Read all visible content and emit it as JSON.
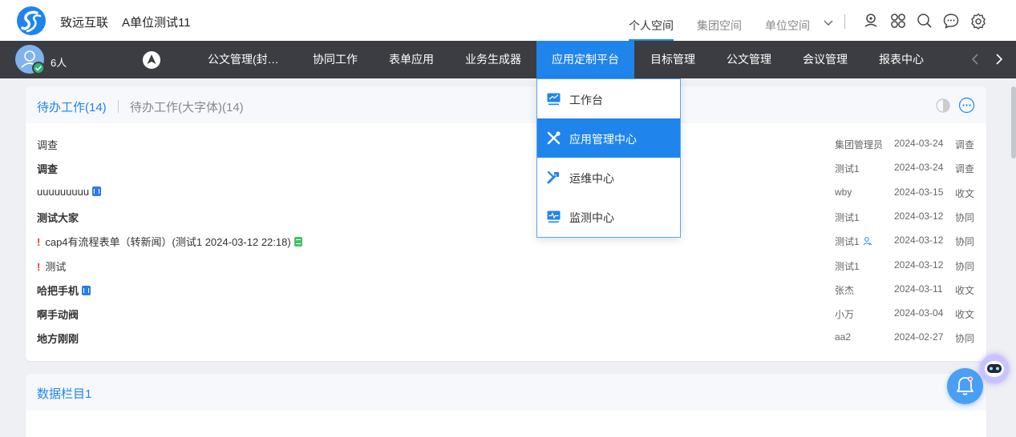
{
  "header": {
    "brand": "致远互联",
    "unit": "A单位测试11",
    "space_tabs": [
      {
        "label": "个人空间",
        "active": true
      },
      {
        "label": "集团空间",
        "active": false
      },
      {
        "label": "单位空间",
        "active": false
      }
    ],
    "icons": [
      "location-pin-icon",
      "apps-icon",
      "search-icon",
      "chat-icon",
      "settings-icon"
    ]
  },
  "navbar": {
    "online_count": "6人",
    "items": [
      {
        "label": "公文管理(封…",
        "active": false
      },
      {
        "label": "协同工作",
        "active": false
      },
      {
        "label": "表单应用",
        "active": false
      },
      {
        "label": "业务生成器",
        "active": false
      },
      {
        "label": "应用定制平台",
        "active": true
      },
      {
        "label": "目标管理",
        "active": false
      },
      {
        "label": "公文管理",
        "active": false
      },
      {
        "label": "会议管理",
        "active": false
      },
      {
        "label": "报表中心",
        "active": false
      }
    ]
  },
  "todo": {
    "tab_active": "待办工作(14)",
    "tab_other": "待办工作(大字体)(14)",
    "rows": [
      {
        "title": "调查",
        "bold": false,
        "urgent": false,
        "badge": "",
        "sender": "集团管理员",
        "person_icon": false,
        "date": "2024-03-24",
        "type": "调查"
      },
      {
        "title": "调查",
        "bold": true,
        "urgent": false,
        "badge": "",
        "sender": "测试1",
        "person_icon": false,
        "date": "2024-03-24",
        "type": "调查"
      },
      {
        "title": "uuuuuuuuu",
        "bold": false,
        "urgent": false,
        "badge": "word",
        "sender": "wby",
        "person_icon": false,
        "date": "2024-03-15",
        "type": "收文"
      },
      {
        "title": "测试大家",
        "bold": true,
        "urgent": false,
        "badge": "",
        "sender": "测试1",
        "person_icon": false,
        "date": "2024-03-12",
        "type": "协同"
      },
      {
        "title": "cap4有流程表单（转新闻）(测试1 2024-03-12 22:18)",
        "bold": false,
        "urgent": true,
        "badge": "form",
        "sender": "测试1",
        "person_icon": true,
        "date": "2024-03-12",
        "type": "协同"
      },
      {
        "title": "测试",
        "bold": false,
        "urgent": true,
        "badge": "",
        "sender": "测试1",
        "person_icon": false,
        "date": "2024-03-12",
        "type": "协同"
      },
      {
        "title": "哈把手机",
        "bold": true,
        "urgent": false,
        "badge": "word",
        "sender": "张杰",
        "person_icon": false,
        "date": "2024-03-11",
        "type": "收文"
      },
      {
        "title": "啊手动阀",
        "bold": true,
        "urgent": false,
        "badge": "",
        "sender": "小万",
        "person_icon": false,
        "date": "2024-03-04",
        "type": "收文"
      },
      {
        "title": "地方刚刚",
        "bold": true,
        "urgent": false,
        "badge": "",
        "sender": "aa2",
        "person_icon": false,
        "date": "2024-02-27",
        "type": "协同"
      }
    ]
  },
  "data_section": {
    "title": "数据栏目1"
  },
  "dropdown": {
    "items": [
      {
        "label": "工作台",
        "icon": "monitor-icon",
        "active": false
      },
      {
        "label": "应用管理中心",
        "icon": "tools-icon",
        "active": true
      },
      {
        "label": "运维中心",
        "icon": "wrench-icon",
        "active": false
      },
      {
        "label": "监测中心",
        "icon": "monitor-chart-icon",
        "active": false
      }
    ]
  },
  "colors": {
    "accent": "#1f85ec",
    "nav_bg": "#3b3d42",
    "urgent": "#e53935"
  }
}
